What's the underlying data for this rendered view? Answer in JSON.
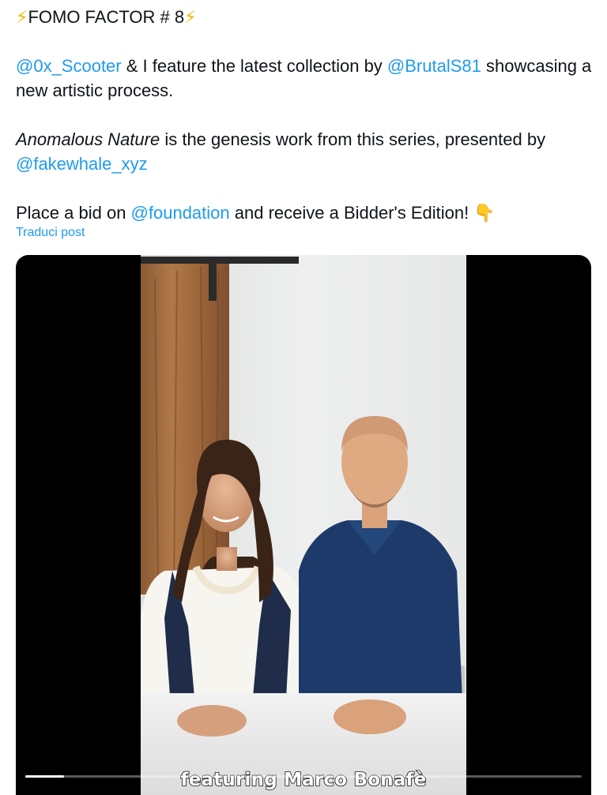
{
  "tweet": {
    "title_text": "FOMO FACTOR # 8",
    "title_emoji": "⚡",
    "para1": {
      "mention1": "@0x_Scooter",
      "text1": " & I feature the latest collection by ",
      "mention2": "@BrutalS81",
      "text2": " showcasing a new artistic process."
    },
    "para2": {
      "italic": "Anomalous Nature",
      "text": " is the genesis work from this series, presented by",
      "mention": "@fakewhale_xyz"
    },
    "para3": {
      "text1": "Place a bid on ",
      "mention": "@foundation",
      "text2": " and receive a Bidder's Edition! ",
      "emoji": "👇"
    },
    "translate_label": "Traduci post"
  },
  "video": {
    "caption": "featuring Marco Bonafè",
    "progress": 0.07
  }
}
